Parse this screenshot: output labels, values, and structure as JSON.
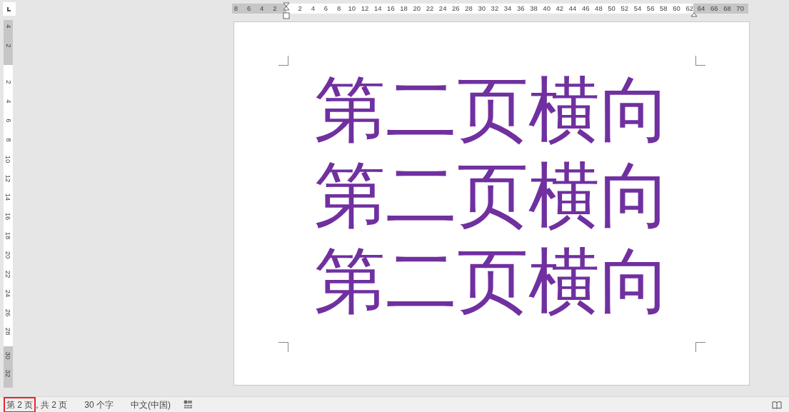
{
  "horizontal_ruler": {
    "segments": [
      {
        "kind": "margin",
        "labels": [
          "8",
          "6",
          "4",
          "2"
        ]
      },
      {
        "kind": "text",
        "labels": [
          "2",
          "4",
          "6",
          "8",
          "10",
          "12",
          "14",
          "16",
          "18",
          "20",
          "22",
          "24",
          "26",
          "28",
          "30",
          "32",
          "34",
          "36",
          "38",
          "40",
          "42",
          "44",
          "46",
          "48",
          "50",
          "52",
          "54",
          "56",
          "58",
          "60",
          "62"
        ]
      },
      {
        "kind": "margin",
        "labels": [
          "64",
          "66",
          "68",
          "70"
        ]
      }
    ]
  },
  "vertical_ruler": {
    "segments": [
      {
        "kind": "margin",
        "labels": [
          "4",
          "2"
        ]
      },
      {
        "kind": "text",
        "labels": [
          "2",
          "4",
          "6",
          "8",
          "10",
          "12",
          "14",
          "16",
          "18",
          "20",
          "22",
          "24",
          "26",
          "28"
        ]
      },
      {
        "kind": "margin",
        "labels": [
          "30",
          "32"
        ]
      }
    ]
  },
  "document": {
    "paragraphs": [
      "第二页横向",
      "第二页横向",
      "第二页横向"
    ]
  },
  "status_bar": {
    "items": [
      {
        "text": "第 2 页",
        "highlighted": true
      },
      {
        "text": ", 共 2 页",
        "highlighted": false
      },
      {
        "text": "30 个字",
        "highlighted": false
      },
      {
        "text": "中文(中国)",
        "highlighted": false
      }
    ]
  }
}
